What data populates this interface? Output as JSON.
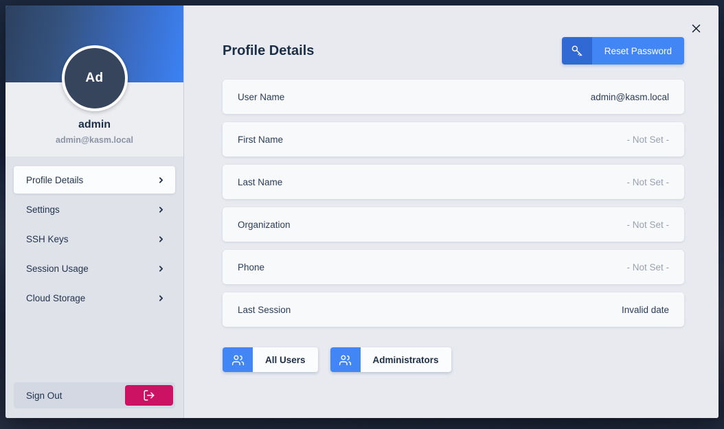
{
  "window": {
    "close_icon": "close-icon"
  },
  "sidebar": {
    "avatar_initials": "Ad",
    "user_name": "admin",
    "user_email": "admin@kasm.local",
    "items": [
      {
        "label": "Profile Details",
        "icon": "chevron-right-icon",
        "active": true
      },
      {
        "label": "Settings",
        "icon": "chevron-right-icon",
        "active": false
      },
      {
        "label": "SSH Keys",
        "icon": "chevron-right-icon",
        "active": false
      },
      {
        "label": "Session Usage",
        "icon": "chevron-right-icon",
        "active": false
      },
      {
        "label": "Cloud Storage",
        "icon": "chevron-right-icon",
        "active": false
      }
    ],
    "signout": {
      "label": "Sign Out",
      "icon": "logout-icon",
      "color": "#cc1262"
    }
  },
  "header": {
    "title": "Profile Details",
    "reset_password": {
      "label": "Reset Password",
      "icon": "key-icon",
      "color": "#4285f4"
    }
  },
  "details": {
    "rows": [
      {
        "label": "User Name",
        "value": "admin@kasm.local",
        "not_set": false
      },
      {
        "label": "First Name",
        "value": "- Not Set -",
        "not_set": true
      },
      {
        "label": "Last Name",
        "value": "- Not Set -",
        "not_set": true
      },
      {
        "label": "Organization",
        "value": "- Not Set -",
        "not_set": true
      },
      {
        "label": "Phone",
        "value": "- Not Set -",
        "not_set": true
      },
      {
        "label": "Last Session",
        "value": "Invalid date",
        "not_set": false
      }
    ]
  },
  "bottom_actions": [
    {
      "label": "All Users",
      "icon": "users-icon"
    },
    {
      "label": "Administrators",
      "icon": "users-icon"
    }
  ],
  "colors": {
    "accent_blue": "#4285f4",
    "accent_blue_dark": "#3069d4",
    "danger_pink": "#cc1262",
    "text_dark": "#1d2e47",
    "text_muted": "#9aa1ae",
    "sidebar_bg": "#dfe2e9",
    "content_bg": "#e8eaf0",
    "card_bg": "#f8f9fb"
  }
}
